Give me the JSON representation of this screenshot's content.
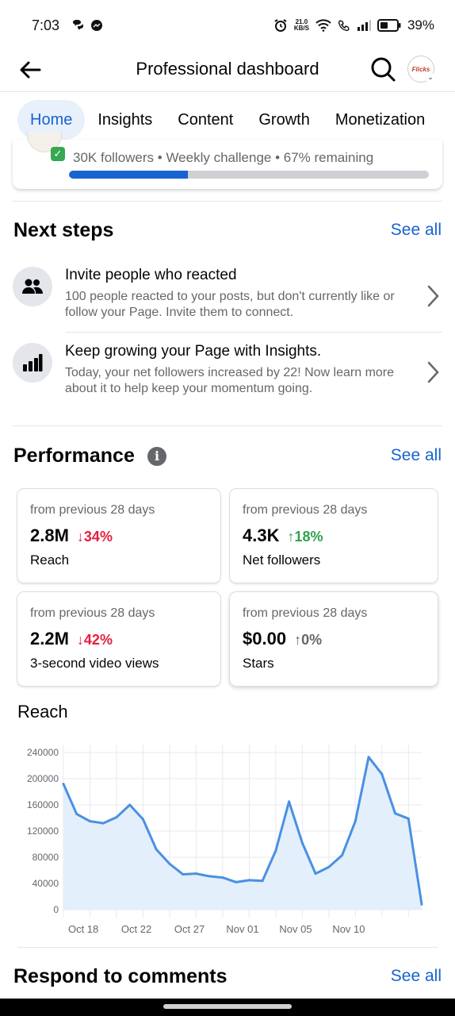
{
  "status_bar": {
    "time": "7:03",
    "network_speed_value": "21.0",
    "network_speed_unit": "KB/S",
    "battery": "39%"
  },
  "header": {
    "title": "Professional dashboard",
    "avatar_text": "Flicks"
  },
  "tabs": [
    {
      "label": "Home",
      "active": true
    },
    {
      "label": "Insights",
      "active": false
    },
    {
      "label": "Content",
      "active": false
    },
    {
      "label": "Growth",
      "active": false
    },
    {
      "label": "Monetization",
      "active": false
    }
  ],
  "challenge": {
    "text": "30K followers • Weekly challenge • 67% remaining",
    "progress": 0.33
  },
  "next_steps": {
    "title": "Next steps",
    "see_all": "See all",
    "items": [
      {
        "icon": "people-icon",
        "title": "Invite people who reacted",
        "description": "100 people reacted to your posts, but don't currently like or follow your Page. Invite them to connect."
      },
      {
        "icon": "bar-chart-icon",
        "title": "Keep growing your Page with Insights.",
        "description": "Today, your net followers increased by 22! Now learn more about it to help keep your momentum going."
      }
    ]
  },
  "performance": {
    "title": "Performance",
    "see_all": "See all",
    "cards": [
      {
        "period": "from previous 28 days",
        "value": "2.8M",
        "change": "↓34%",
        "change_color": "#e41e3f",
        "label": "Reach"
      },
      {
        "period": "from previous 28 days",
        "value": "4.3K",
        "change": "↑18%",
        "change_color": "#31a24c",
        "label": "Net followers"
      },
      {
        "period": "from previous 28 days",
        "value": "2.2M",
        "change": "↓42%",
        "change_color": "#e41e3f",
        "label": "3-second video views"
      },
      {
        "period": "from previous 28 days",
        "value": "$0.00",
        "change": "↑0%",
        "change_color": "#65676b",
        "label": "Stars"
      }
    ]
  },
  "chart_data": {
    "type": "area",
    "title": "Reach",
    "xlabel": "",
    "ylabel": "",
    "ylim": [
      0,
      240000
    ],
    "yticks": [
      0,
      40000,
      80000,
      120000,
      160000,
      200000,
      240000
    ],
    "x_tick_labels": [
      "Oct 18",
      "Oct 22",
      "Oct 27",
      "Nov 01",
      "Nov 05",
      "Nov 10"
    ],
    "x_tick_index": [
      1.5,
      5.5,
      9.5,
      13.5,
      17.5,
      21.5
    ],
    "grid": true,
    "line_color": "#4a90e2",
    "fill_color": "#e3effb",
    "series": [
      {
        "values": [
          192000,
          146000,
          135000,
          132000,
          141000,
          160000,
          138000,
          92000,
          70000,
          54000,
          55000,
          51000,
          49000,
          42000,
          45000,
          44000,
          90000,
          165000,
          102000,
          55000,
          65000,
          83000,
          135000,
          233000,
          207000,
          147000,
          139000,
          8000
        ]
      }
    ]
  },
  "comments": {
    "title": "Respond to comments",
    "see_all": "See all"
  }
}
